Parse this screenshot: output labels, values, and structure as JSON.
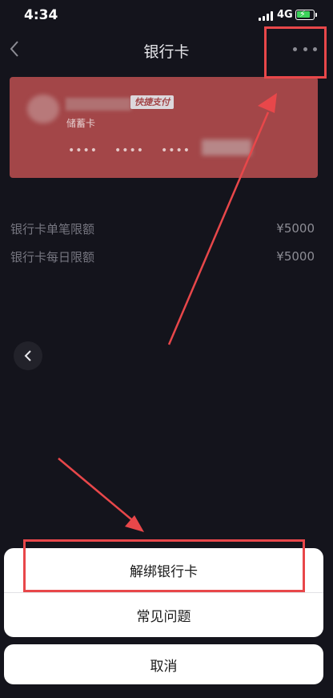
{
  "status_bar": {
    "time": "4:34",
    "network": "4G",
    "battery_color": "#3cd35a"
  },
  "nav": {
    "title": "银行卡",
    "back_icon": "chevron-left-icon",
    "more_icon": "more-horizontal-icon"
  },
  "card": {
    "background_color": "#a34648",
    "quick_pay_badge": "快捷支付",
    "card_type": "储蓄卡",
    "masked_groups": [
      "••••",
      "••••",
      "••••"
    ]
  },
  "limits": [
    {
      "label": "银行卡单笔限额",
      "value": "¥5000"
    },
    {
      "label": "银行卡每日限额",
      "value": "¥5000"
    }
  ],
  "action_sheet": {
    "items": [
      {
        "label": "解绑银行卡"
      },
      {
        "label": "常见问题"
      }
    ],
    "cancel_label": "取消"
  },
  "annotation_color": "#e8474a"
}
